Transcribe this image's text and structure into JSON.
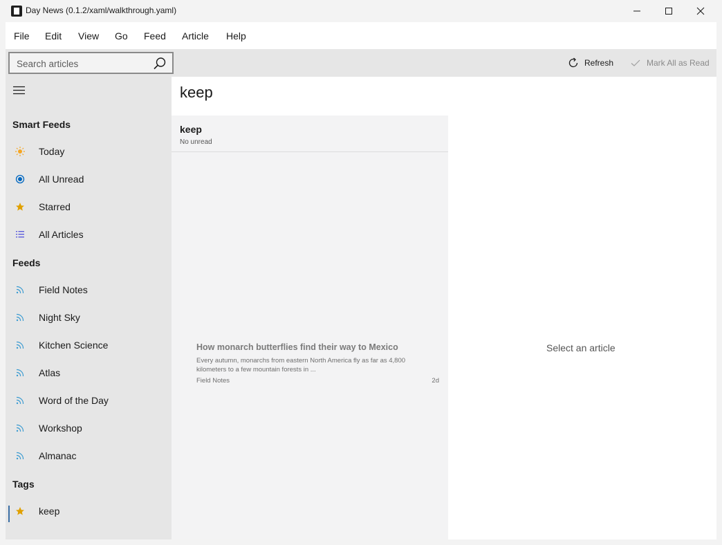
{
  "window": {
    "title": "Day News (0.1.2/xaml/walkthrough.yaml)"
  },
  "menu": [
    "File",
    "Edit",
    "View",
    "Go",
    "Feed",
    "Article",
    "Help"
  ],
  "toolbar": {
    "search_placeholder": "Search articles",
    "refresh_label": "Refresh",
    "mark_all_label": "Mark All as Read"
  },
  "sidebar": {
    "smart_feeds_title": "Smart Feeds",
    "smart_feeds": [
      {
        "label": "Today",
        "icon": "sun-icon"
      },
      {
        "label": "All Unread",
        "icon": "radio-dot-icon"
      },
      {
        "label": "Starred",
        "icon": "star-icon"
      },
      {
        "label": "All Articles",
        "icon": "list-icon"
      }
    ],
    "feeds_title": "Feeds",
    "feeds": [
      {
        "label": "Field Notes",
        "icon": "rss-icon"
      },
      {
        "label": "Night Sky",
        "icon": "rss-icon"
      },
      {
        "label": "Kitchen Science",
        "icon": "rss-icon"
      },
      {
        "label": "Atlas",
        "icon": "rss-icon"
      },
      {
        "label": "Word of the Day",
        "icon": "rss-icon"
      },
      {
        "label": "Workshop",
        "icon": "rss-icon"
      },
      {
        "label": "Almanac",
        "icon": "rss-icon"
      }
    ],
    "tags_title": "Tags",
    "tags": [
      {
        "label": "keep",
        "icon": "star-icon",
        "selected": true
      }
    ]
  },
  "main": {
    "title": "keep",
    "list_header": {
      "title": "keep",
      "subtitle": "No unread"
    },
    "articles": [
      {
        "title": "How monarch butterflies find their way to Mexico",
        "excerpt": "Every autumn, monarchs from eastern North America fly as far as 4,800 kilometers to a few mountain forests in ...",
        "feed": "Field Notes",
        "age": "2d"
      }
    ],
    "detail_placeholder": "Select an article"
  },
  "colors": {
    "accent": "#0067c0",
    "star": "#e0a000",
    "sun": "#f5a623",
    "rss": "#3b9bd1",
    "list": "#5a5adc"
  }
}
